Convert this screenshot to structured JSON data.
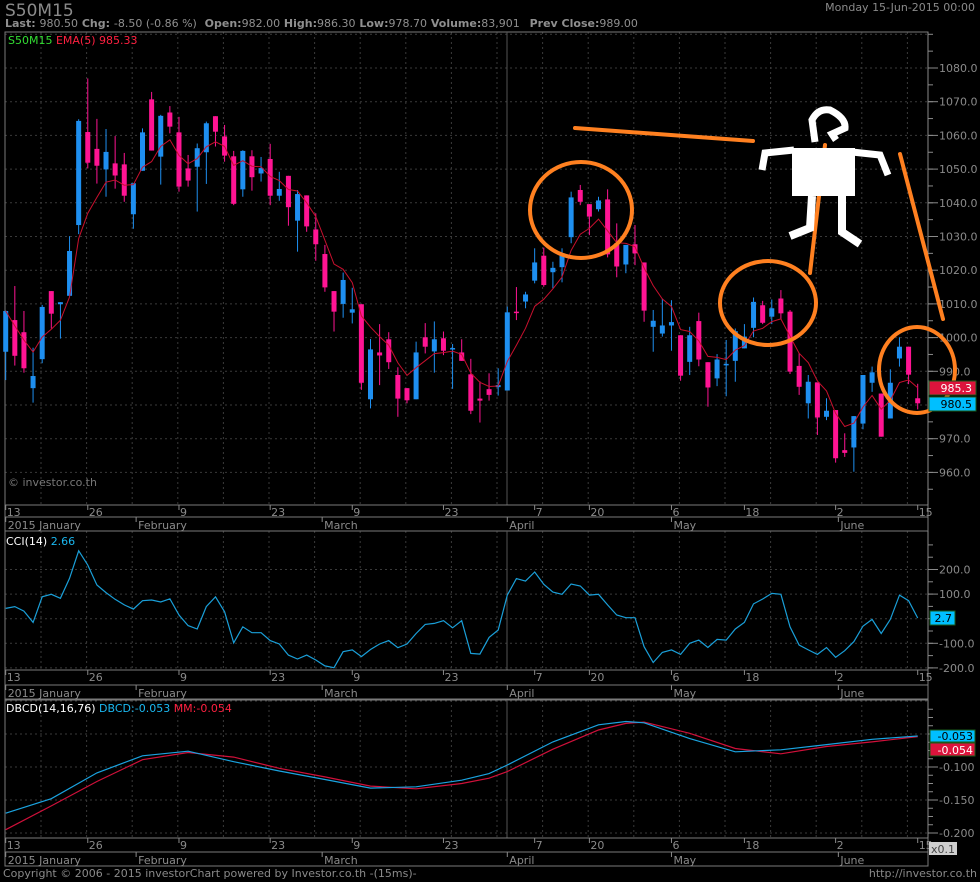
{
  "header": {
    "symbol": "S50M15",
    "datetime": "Monday 15-Jun-2015 00:00",
    "last_label": "Last:",
    "last": "980.50",
    "chg_label": "Chg:",
    "chg": "-8.50 (-0.86 %)",
    "open_label": "Open:",
    "open": "982.00",
    "high_label": "High:",
    "high": "986.30",
    "low_label": "Low:",
    "low": "978.70",
    "volume_label": "Volume:",
    "volume": "83,901",
    "prev_close_label": "Prev Close:",
    "prev_close": "989.00"
  },
  "main_legend": {
    "symbol": "S50M15",
    "ema": "EMA(5) 985.33"
  },
  "watermark": "© investor.co.th",
  "price_badges": {
    "ema": "985.3",
    "last": "980.5"
  },
  "cci_legend": {
    "name": "CCI(14)",
    "value": "2.66"
  },
  "cci_badge": "2.7",
  "dbcd_legend": {
    "name": "DBCD(14,16,76)",
    "dbcd": "DBCD:-0.053",
    "mm": "MM:-0.054"
  },
  "dbcd_badges": {
    "dbcd": "-0.053",
    "mm": "-0.054"
  },
  "scale_label": "x0.1",
  "footer": {
    "copyright": "Copyright © 2006 - 2015 investorChart powered by Investor.co.th -(15ms)-",
    "url": "http://investor.co.th"
  },
  "colors": {
    "up": "#1e8ff0",
    "down": "#ff1493",
    "ema": "#c8102e",
    "cci": "#1a9fd8",
    "dbcd": "#1aa3e0",
    "mm": "#d0103a",
    "annotation": "#ff8020",
    "drawing": "#ffffff"
  },
  "chart_data": [
    {
      "type": "candlestick",
      "series_name": "S50M15",
      "ylim": [
        950,
        1090
      ],
      "y_ticks": [
        "1080.0",
        "1070.0",
        "1060.0",
        "1050.0",
        "1040.0",
        "1030.0",
        "1020.0",
        "1010.0",
        "1000.0",
        "990.0",
        "980.0",
        "970.0",
        "960.0"
      ],
      "day_ticks": [
        {
          "label": "13",
          "i": 0
        },
        {
          "label": "26",
          "i": 9
        },
        {
          "label": "9",
          "i": 19
        },
        {
          "label": "23",
          "i": 29
        },
        {
          "label": "9",
          "i": 38
        },
        {
          "label": "23",
          "i": 48
        },
        {
          "label": "7",
          "i": 58
        },
        {
          "label": "20",
          "i": 64
        },
        {
          "label": "6",
          "i": 73
        },
        {
          "label": "18",
          "i": 81
        },
        {
          "label": "2",
          "i": 91
        },
        {
          "label": "15",
          "i": 100
        }
      ],
      "month_ticks": [
        {
          "label": "2015 January",
          "i": 0
        },
        {
          "label": "February",
          "i": 14.3
        },
        {
          "label": "March",
          "i": 34.7
        },
        {
          "label": "April",
          "i": 55
        },
        {
          "label": "May",
          "i": 73
        },
        {
          "label": "June",
          "i": 91.3
        }
      ],
      "ohlc": [
        [
          995.8,
          1008,
          987.4,
          1007.9
        ],
        [
          1005.2,
          1015.3,
          991.7,
          994.6
        ],
        [
          1001.6,
          1007.9,
          989.6,
          990.9
        ],
        [
          985,
          997,
          980.7,
          988.6
        ],
        [
          993.6,
          1009.7,
          992.4,
          1009.1
        ],
        [
          1013.8,
          1013.8,
          1002.7,
          1007.1
        ],
        [
          1009.9,
          1010.5,
          999.7,
          1010.5
        ],
        [
          1012.4,
          1030.1,
          1012.4,
          1025.7
        ],
        [
          1033.4,
          1064.8,
          1030.7,
          1064.3
        ],
        [
          1061,
          1076.9,
          1050.2,
          1051.9
        ],
        [
          1056,
          1064.9,
          1045.7,
          1051
        ],
        [
          1049.9,
          1061.9,
          1041.8,
          1055.1
        ],
        [
          1051.7,
          1059.8,
          1044.2,
          1048.1
        ],
        [
          1051.4,
          1054.8,
          1040.3,
          1042.1
        ],
        [
          1036.6,
          1045.8,
          1032.3,
          1045.8
        ],
        [
          1049.5,
          1062.1,
          1049.5,
          1060.9
        ],
        [
          1070.7,
          1072.9,
          1055.5,
          1055.5
        ],
        [
          1053.7,
          1066.1,
          1045.4,
          1065.8
        ],
        [
          1066.8,
          1068.7,
          1060.6,
          1062.6
        ],
        [
          1060.9,
          1065.5,
          1043.3,
          1044.8
        ],
        [
          1050.2,
          1054.2,
          1044.8,
          1046.6
        ],
        [
          1050.7,
          1057.6,
          1037.4,
          1056.2
        ],
        [
          1055,
          1064.1,
          1045.6,
          1063.6
        ],
        [
          1065.7,
          1065.7,
          1056.7,
          1061.1
        ],
        [
          1059.7,
          1063.1,
          1052.2,
          1054
        ],
        [
          1053.8,
          1055.4,
          1039.3,
          1039.7
        ],
        [
          1044,
          1055.6,
          1041.8,
          1055.4
        ],
        [
          1053.8,
          1055.6,
          1043.6,
          1047.6
        ],
        [
          1048.7,
          1053.6,
          1046.3,
          1050.3
        ],
        [
          1053,
          1057.5,
          1039.3,
          1042.1
        ],
        [
          1042.1,
          1049.2,
          1040.6,
          1044.1
        ],
        [
          1048,
          1048,
          1033.2,
          1038.7
        ],
        [
          1034.7,
          1043.8,
          1025.5,
          1042.6
        ],
        [
          1042.2,
          1042.2,
          1031.4,
          1033
        ],
        [
          1032.1,
          1036.9,
          1022.8,
          1027.7
        ],
        [
          1024.8,
          1027.5,
          1013.6,
          1014.9
        ],
        [
          1013.8,
          1013.8,
          1001.8,
          1007.7
        ],
        [
          1010,
          1019.3,
          1005.9,
          1017.1
        ],
        [
          1007.4,
          1014.8,
          1004.2,
          1008.4
        ],
        [
          1009.9,
          1009.9,
          984.5,
          986.6
        ],
        [
          981.7,
          999.6,
          979,
          996.5
        ],
        [
          995.6,
          1004,
          985.9,
          994.7
        ],
        [
          999.5,
          1001.6,
          990.7,
          992.7
        ],
        [
          988.9,
          991.2,
          976.5,
          981.9
        ],
        [
          985,
          985,
          980.5,
          981.4
        ],
        [
          981.7,
          998.8,
          981.7,
          995.6
        ],
        [
          1000.1,
          1004.3,
          995.3,
          997.3
        ],
        [
          995.9,
          1004.8,
          989.6,
          999.5
        ],
        [
          999.8,
          1001.8,
          994.8,
          996.1
        ],
        [
          996.5,
          998.1,
          984.8,
          996.9
        ],
        [
          995.6,
          999.5,
          993.1,
          993.1
        ],
        [
          989.1,
          993.7,
          977.3,
          978.3
        ],
        [
          981.9,
          987,
          974.8,
          981.3
        ],
        [
          984.7,
          989.4,
          981.3,
          983
        ],
        [
          985.3,
          990.9,
          982.8,
          985.9
        ],
        [
          984.3,
          1009.2,
          984.3,
          1007.5
        ],
        [
          1007.7,
          1015,
          1005.2,
          1007.4
        ],
        [
          1010.7,
          1013.6,
          1008.7,
          1012.8
        ],
        [
          1016.9,
          1026.5,
          1016.1,
          1022.3
        ],
        [
          1024.3,
          1026.7,
          1015.1,
          1015.6
        ],
        [
          1019.4,
          1022.5,
          1014.6,
          1020.7
        ],
        [
          1020.9,
          1026.5,
          1016.4,
          1025
        ],
        [
          1029.8,
          1043.3,
          1028,
          1041.6
        ],
        [
          1043.8,
          1045.3,
          1039.3,
          1040.3
        ],
        [
          1039.6,
          1039.6,
          1030.4,
          1035.9
        ],
        [
          1038.1,
          1041.8,
          1037.4,
          1040.7
        ],
        [
          1041,
          1044,
          1023.8,
          1024.7
        ],
        [
          1028,
          1033.9,
          1017.9,
          1021.1
        ],
        [
          1021.7,
          1027.5,
          1019.1,
          1027.5
        ],
        [
          1027.7,
          1033.4,
          1021.5,
          1025
        ],
        [
          1022.3,
          1022.3,
          1004.7,
          1008
        ],
        [
          1003.2,
          1008.2,
          995.8,
          1005
        ],
        [
          1001.2,
          1011.6,
          1000.3,
          1003.6
        ],
        [
          1003.6,
          1011.1,
          996.1,
          1004.6
        ],
        [
          1000.7,
          1000.7,
          987.2,
          988.7
        ],
        [
          992.8,
          1003.2,
          988.9,
          1000.7
        ],
        [
          1004.9,
          1007.4,
          991.5,
          993.5
        ],
        [
          992.7,
          992.7,
          979.5,
          985.2
        ],
        [
          987.9,
          995.1,
          985.6,
          993.5
        ],
        [
          991.9,
          999.3,
          982.6,
          992.2
        ],
        [
          993.1,
          1002.7,
          986.9,
          1001.9
        ],
        [
          996.8,
          1004,
          996.8,
          1000.3
        ],
        [
          1002.9,
          1011.9,
          1000.1,
          1010.6
        ],
        [
          1009.6,
          1010.9,
          1004,
          1004.4
        ],
        [
          1006.2,
          1011.3,
          1004,
          1008.7
        ],
        [
          1011.6,
          1014.1,
          1005.4,
          1007.2
        ],
        [
          1007.7,
          1008.2,
          989.2,
          989.9
        ],
        [
          991.6,
          995.3,
          983,
          985.4
        ],
        [
          980.5,
          988.9,
          976,
          986.9
        ],
        [
          986.7,
          986.7,
          971.1,
          976.3
        ],
        [
          976.5,
          982,
          975.5,
          978.3
        ],
        [
          978.5,
          978.5,
          962.9,
          964.2
        ],
        [
          966.6,
          971.6,
          964.6,
          965.8
        ],
        [
          967.4,
          976.7,
          960.2,
          976.7
        ],
        [
          974.5,
          988.9,
          972.8,
          988.9
        ],
        [
          986.6,
          991.4,
          983.9,
          989.7
        ],
        [
          983.4,
          983.4,
          970.6,
          970.6
        ],
        [
          976,
          990.6,
          976,
          986.6
        ],
        [
          993.8,
          1000.1,
          991.4,
          997.3
        ],
        [
          997.3,
          997.3,
          986.2,
          989
        ],
        [
          982,
          986.3,
          978.7,
          980.5
        ]
      ],
      "overlay": {
        "name": "EMA(5)",
        "period": 5
      }
    },
    {
      "type": "line",
      "series_name": "CCI(14)",
      "ylim": [
        -230,
        300
      ],
      "y_ticks": [
        "200.0",
        "100.0",
        "-100.0",
        "-200.0"
      ],
      "values": [
        42,
        49,
        31,
        -15,
        89,
        99,
        83,
        164,
        276,
        218,
        137,
        106,
        79,
        56,
        39,
        73,
        76,
        68,
        81,
        15,
        -28,
        -42,
        49,
        89,
        28,
        -98,
        -33,
        -57,
        -57,
        -89,
        -103,
        -148,
        -164,
        -148,
        -168,
        -192,
        -199,
        -134,
        -127,
        -154,
        -125,
        -103,
        -89,
        -118,
        -103,
        -60,
        -23,
        -19,
        -8,
        -37,
        -8,
        -141,
        -144,
        -76,
        -46,
        96,
        163,
        153,
        190,
        140,
        108,
        99,
        141,
        133,
        96,
        99,
        56,
        15,
        4,
        4,
        -114,
        -178,
        -137,
        -127,
        -145,
        -100,
        -87,
        -117,
        -84,
        -87,
        -42,
        -15,
        60,
        80,
        103,
        99,
        -33,
        -107,
        -127,
        -145,
        -117,
        -157,
        -130,
        -93,
        -30,
        -3,
        -60,
        -3,
        96,
        73,
        2.66
      ]
    },
    {
      "type": "line",
      "ylim": [
        -0.205,
        0.0
      ],
      "y_ticks": [
        "-0.100",
        "-0.150",
        "-0.200"
      ],
      "x": [
        0,
        5,
        10,
        15,
        20,
        25,
        30,
        35,
        40,
        45,
        50,
        53,
        55,
        60,
        65,
        68,
        70,
        75,
        80,
        85,
        90,
        95,
        100
      ],
      "series": [
        {
          "name": "DBCD",
          "values": [
            -0.17,
            -0.148,
            -0.109,
            -0.083,
            -0.076,
            -0.092,
            -0.106,
            -0.119,
            -0.132,
            -0.13,
            -0.12,
            -0.11,
            -0.097,
            -0.062,
            -0.036,
            -0.031,
            -0.033,
            -0.057,
            -0.077,
            -0.074,
            -0.066,
            -0.058,
            -0.053
          ]
        },
        {
          "name": "MM",
          "values": [
            -0.195,
            -0.159,
            -0.122,
            -0.089,
            -0.078,
            -0.085,
            -0.102,
            -0.115,
            -0.129,
            -0.133,
            -0.125,
            -0.117,
            -0.107,
            -0.073,
            -0.044,
            -0.034,
            -0.032,
            -0.049,
            -0.072,
            -0.08,
            -0.069,
            -0.062,
            -0.054
          ]
        }
      ]
    }
  ]
}
